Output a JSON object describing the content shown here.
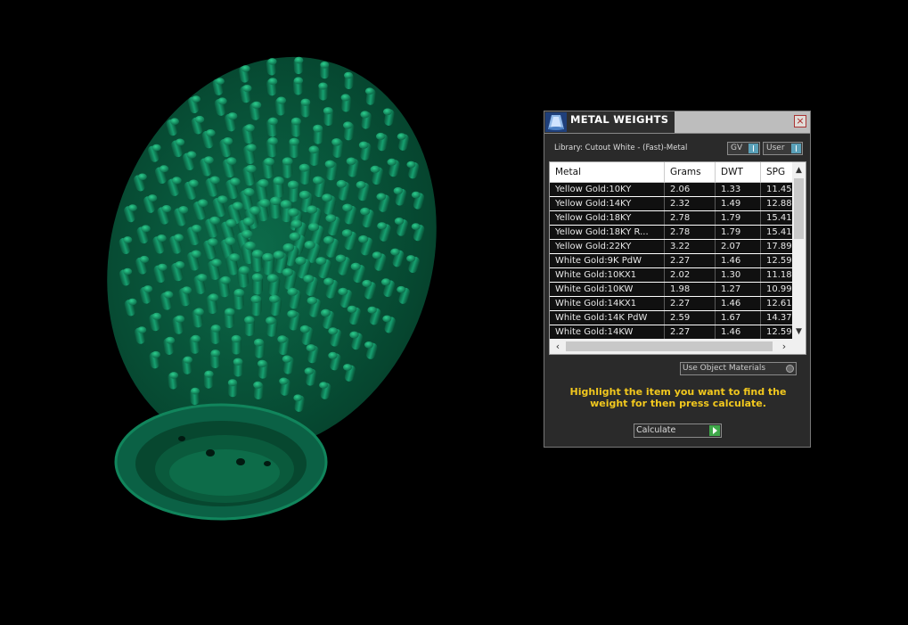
{
  "dialog": {
    "title": "METAL WEIGHTS",
    "close_label": "×",
    "library_text": "Library: Cutout White - (Fast)-Metal",
    "toggle_gv": "GV",
    "toggle_user": "User",
    "columns": [
      "Metal",
      "Grams",
      "DWT",
      "SPG"
    ],
    "rows": [
      {
        "metal": "Yellow Gold:10KY",
        "grams": "2.06",
        "dwt": "1.33",
        "spg": "11.45"
      },
      {
        "metal": "Yellow Gold:14KY",
        "grams": "2.32",
        "dwt": "1.49",
        "spg": "12.88"
      },
      {
        "metal": "Yellow Gold:18KY",
        "grams": "2.78",
        "dwt": "1.79",
        "spg": "15.41"
      },
      {
        "metal": "Yellow Gold:18KY R...",
        "grams": "2.78",
        "dwt": "1.79",
        "spg": "15.41"
      },
      {
        "metal": "Yellow Gold:22KY",
        "grams": "3.22",
        "dwt": "2.07",
        "spg": "17.89"
      },
      {
        "metal": "White Gold:9K PdW",
        "grams": "2.27",
        "dwt": "1.46",
        "spg": "12.59"
      },
      {
        "metal": "White Gold:10KX1",
        "grams": "2.02",
        "dwt": "1.30",
        "spg": "11.18"
      },
      {
        "metal": "White Gold:10KW",
        "grams": "1.98",
        "dwt": "1.27",
        "spg": "10.99"
      },
      {
        "metal": "White Gold:14KX1",
        "grams": "2.27",
        "dwt": "1.46",
        "spg": "12.61"
      },
      {
        "metal": "White Gold:14K PdW",
        "grams": "2.59",
        "dwt": "1.67",
        "spg": "14.37"
      },
      {
        "metal": "White Gold:14KW",
        "grams": "2.27",
        "dwt": "1.46",
        "spg": "12.59"
      }
    ],
    "use_object_materials": "Use Object Materials",
    "hint": "Highlight the item you want to find the weight for then press calculate.",
    "calculate": "Calculate"
  },
  "colors": {
    "model_green": "#0f7a55",
    "hint_yellow": "#f2c81e",
    "dialog_bg": "#2a2a2a"
  }
}
